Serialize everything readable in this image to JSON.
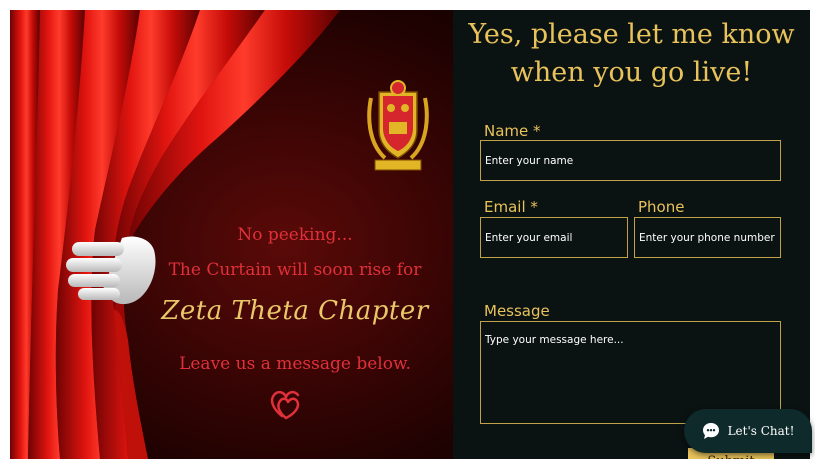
{
  "left": {
    "tease_line1": "No peeking...",
    "tease_line2": "The Curtain will soon rise for",
    "chapter_name": "Zeta Theta Chapter",
    "tease_line3": "Leave us a message below.",
    "crest_icon": "sorority-crest-icon",
    "hearts_icon": "double-heart-icon"
  },
  "form": {
    "headline": "Yes, please let me know when you go live!",
    "name_label": "Name *",
    "name_placeholder": "Enter your name",
    "email_label": "Email *",
    "email_placeholder": "Enter your email",
    "phone_label": "Phone",
    "phone_placeholder": "Enter your phone number",
    "message_label": "Message",
    "message_placeholder": "Type your message here...",
    "submit_label": "Submit"
  },
  "chat": {
    "label": "Let's Chat!",
    "icon": "chat-bubble-icon"
  },
  "colors": {
    "gold": "#e8c25a",
    "red_text": "#e0303a",
    "form_bg": "#0b1212",
    "chat_bg": "#0f2a2b"
  }
}
